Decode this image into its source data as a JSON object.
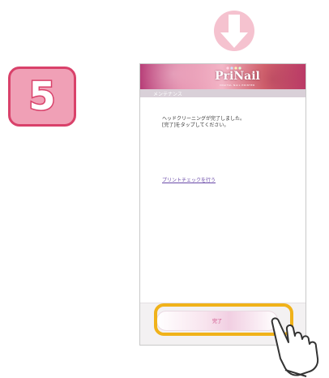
{
  "step": {
    "number": "5"
  },
  "app": {
    "logo": "PriNail",
    "logo_sub": "DIGITAL NAIL PRINTER",
    "section_title": "メンテナンス"
  },
  "content": {
    "message_line1": "ヘッドクリーニングが完了しました。",
    "message_line2": "[完了]をタップしてください。",
    "print_check_link": "プリントチェックを行う"
  },
  "footer": {
    "complete_button": "完了"
  },
  "colors": {
    "accent_pink": "#d9416a",
    "highlight": "#f0b21a",
    "link": "#6a4aa8"
  },
  "icons": {
    "arrow": "down-arrow-icon",
    "hand": "pointing-hand-icon"
  }
}
